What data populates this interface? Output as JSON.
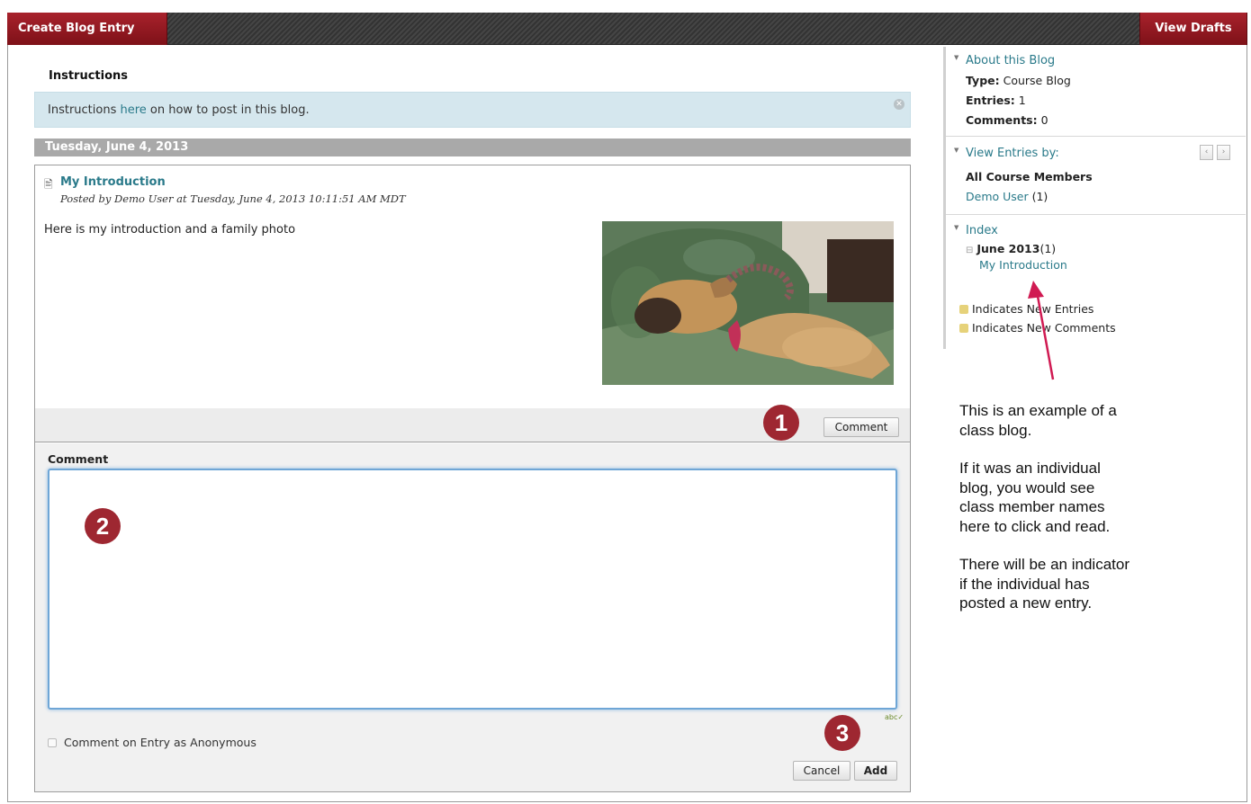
{
  "toolbar": {
    "create_label": "Create Blog Entry",
    "drafts_label": "View Drafts"
  },
  "instructions": {
    "title": "Instructions",
    "text_before": "Instructions ",
    "link": "here",
    "text_after": " on how to post in this blog."
  },
  "date_header": "Tuesday, June 4, 2013",
  "entry": {
    "title": "My Introduction",
    "meta": "Posted by  Demo User  at Tuesday, June 4, 2013 10:11:51 AM MDT",
    "body": "Here is my introduction and a family photo",
    "comment_button": "Comment"
  },
  "comment_form": {
    "label": "Comment",
    "value": "",
    "anonymous_label": "Comment on Entry as Anonymous",
    "cancel_label": "Cancel",
    "add_label": "Add"
  },
  "markers": [
    "1",
    "2",
    "3"
  ],
  "sidebar": {
    "about": {
      "heading": "About this Blog",
      "type_label": "Type:",
      "type_value": "Course Blog",
      "entries_label": "Entries:",
      "entries_value": "1",
      "comments_label": "Comments:",
      "comments_value": "0"
    },
    "view_entries": {
      "heading": "View Entries by:",
      "all_members": "All Course Members",
      "user_name": "Demo User",
      "user_count": "(1)"
    },
    "index": {
      "heading": "Index",
      "month": "June 2013",
      "month_count": "(1)",
      "entry_link": "My Introduction",
      "legend_new_entries": "Indicates New Entries",
      "legend_new_comments": "Indicates New Comments"
    }
  },
  "annotation": {
    "p1": "This is an example of a\nclass blog.",
    "p2": "If it was an individual\nblog, you would see\nclass member names\nhere to click and read.",
    "p3": "There will be an indicator\nif the individual has\nposted a new entry."
  },
  "colors": {
    "accent_red": "#9e2731",
    "link_teal": "#2a7a8a",
    "instructions_bg": "#d5e7ee"
  }
}
